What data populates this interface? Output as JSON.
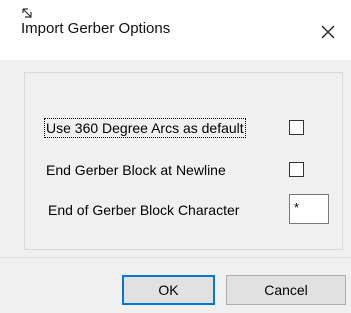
{
  "dialog": {
    "title": "Import Gerber Options",
    "close_symbol": "✕"
  },
  "options": {
    "use_360_arcs": {
      "label": "Use 360 Degree Arcs as default",
      "checked": false
    },
    "end_block_newline": {
      "label": "End Gerber Block at Newline",
      "checked": false
    },
    "end_block_char": {
      "label": "End of Gerber Block Character",
      "value": "*"
    }
  },
  "buttons": {
    "ok_label": "OK",
    "cancel_label": "Cancel"
  },
  "colors": {
    "accent": "#0078d7",
    "body_bg": "#f0f0f0",
    "title_bg": "#ffffff"
  },
  "icons": {
    "app": "app-icon",
    "close": "close-icon"
  }
}
